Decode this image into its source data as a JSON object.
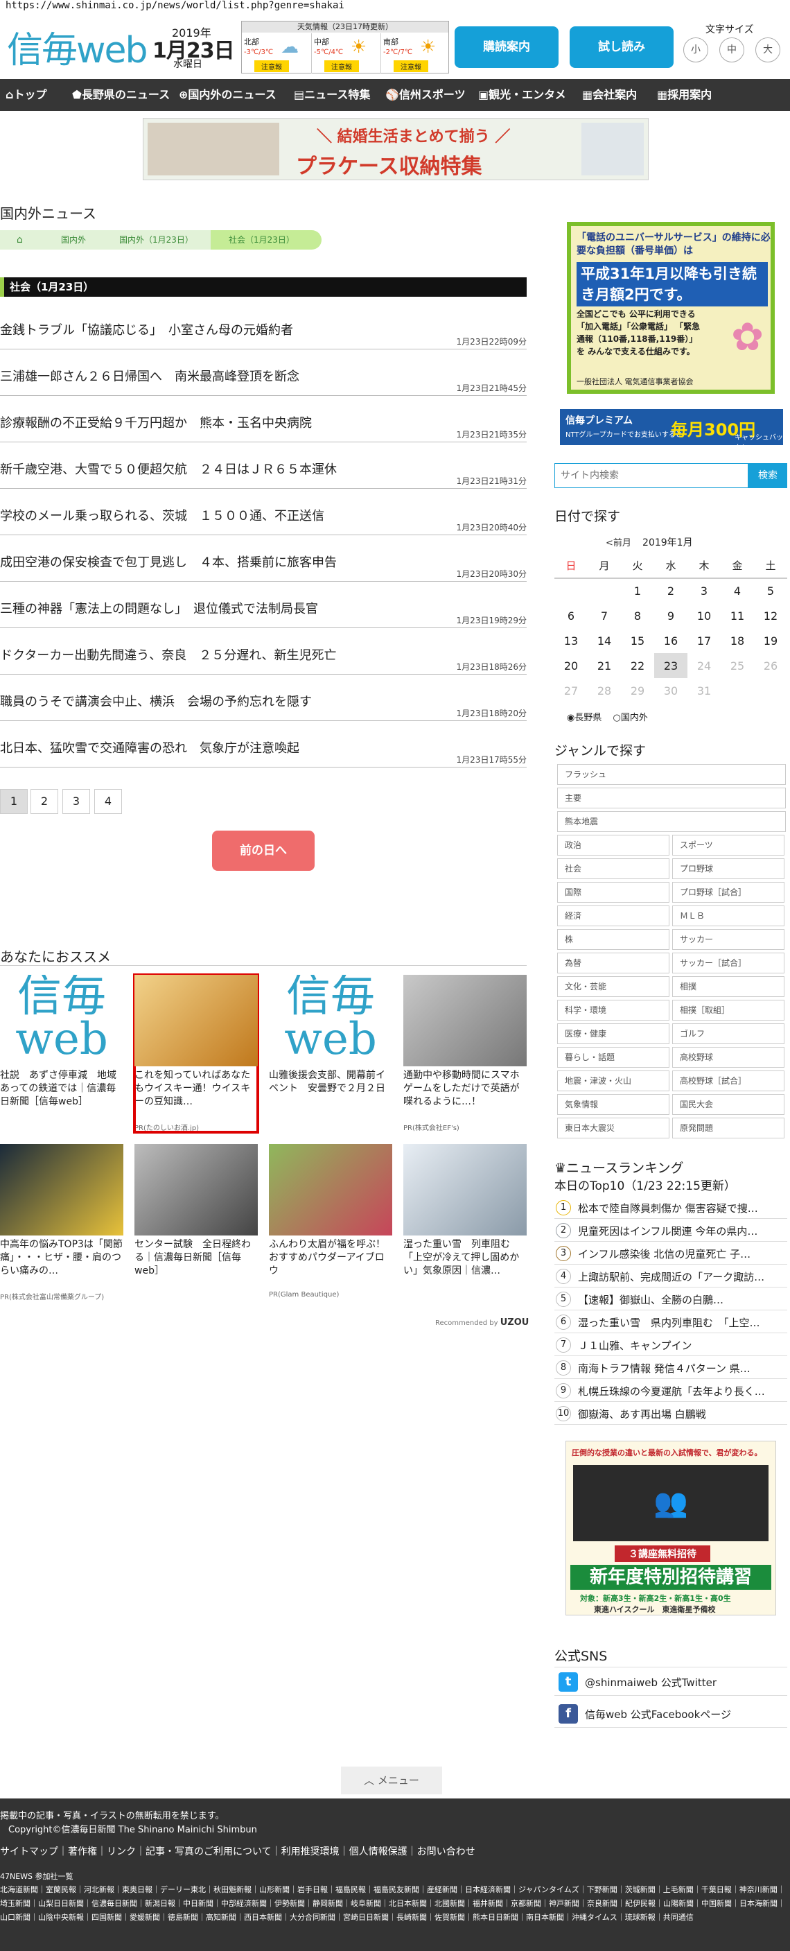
{
  "url": "https://www.shinmai.co.jp/news/world/list.php?genre=shakai",
  "logo": {
    "a": "信毎",
    "b": "web"
  },
  "date": {
    "year": "2019年",
    "day": "1月23日",
    "weekday": "水曜日"
  },
  "weather": {
    "header": "天気情報（23日17時更新）",
    "cells": [
      {
        "name": "北部",
        "temp": "-3℃/3℃",
        "warn": "注意報"
      },
      {
        "name": "中部",
        "temp": "-5℃/4℃",
        "warn": "注意報"
      },
      {
        "name": "南部",
        "temp": "-2℃/7℃",
        "warn": "注意報"
      }
    ]
  },
  "header_buttons": {
    "delivery": "購読案内",
    "trial": "試し読み"
  },
  "font_size": {
    "label": "文字サイズ",
    "s": "小",
    "m": "中",
    "l": "大"
  },
  "nav": [
    "トップ",
    "長野県のニュース",
    "国内外のニュース",
    "ニュース特集",
    "信州スポーツ",
    "観光・エンタメ",
    "会社案内",
    "採用案内"
  ],
  "banner_ad": {
    "line1": "＼ 結婚生活まとめて揃う ／",
    "line2": "プラケース収納特集"
  },
  "section_title": "国内外ニュース",
  "breadcrumbs": [
    "国内外",
    "国内外（1月23日）",
    "社会（1月23日）"
  ],
  "list_header": "社会（1月23日）",
  "news": [
    {
      "title": "金銭トラブル「協議応じる」　小室さん母の元婚約者",
      "time": "1月23日22時09分"
    },
    {
      "title": "三浦雄一郎さん２６日帰国へ　南米最高峰登頂を断念",
      "time": "1月23日21時45分"
    },
    {
      "title": "診療報酬の不正受給９千万円超か　熊本・玉名中央病院",
      "time": "1月23日21時35分"
    },
    {
      "title": "新千歳空港、大雪で５０便超欠航　２４日はＪＲ６５本運休",
      "time": "1月23日21時31分"
    },
    {
      "title": "学校のメール乗っ取られる、茨城　１５００通、不正送信",
      "time": "1月23日20時40分"
    },
    {
      "title": "成田空港の保安検査で包丁見逃し　４本、搭乗前に旅客申告",
      "time": "1月23日20時30分"
    },
    {
      "title": "三種の神器「憲法上の問題なし」　退位儀式で法制局長官",
      "time": "1月23日19時29分"
    },
    {
      "title": "ドクターカー出動先間違う、奈良　２５分遅れ、新生児死亡",
      "time": "1月23日18時26分"
    },
    {
      "title": "職員のうそで講演会中止、横浜　会場の予約忘れを隠す",
      "time": "1月23日18時20分"
    },
    {
      "title": "北日本、猛吹雪で交通障害の恐れ　気象庁が注意喚起",
      "time": "1月23日17時55分"
    }
  ],
  "pages": [
    "1",
    "2",
    "3",
    "4"
  ],
  "prev_button": "前の日へ",
  "recommend_title": "あなたにおススメ",
  "recommend": [
    {
      "caption": "社説　あずさ停車減　地域あっての鉄道では｜信濃毎日新聞［信毎web］",
      "pr": ""
    },
    {
      "caption": "これを知っていればあなたもウイスキー通！ウイスキーの豆知識…",
      "pr": "PR(たのしいお酒.jp)"
    },
    {
      "caption": "山雅後援会支部、開幕前イベント　安曇野で２月２日",
      "pr": ""
    },
    {
      "caption": "通勤中や移動時間にスマホゲームをしただけで英語が喋れるように…！",
      "pr": "PR(株式会社EF's)"
    },
    {
      "caption": "中高年の悩みTOP3は「関節痛」・・・ヒザ・腰・肩のつらい痛みの…",
      "pr": "PR(株式会社富山常備薬グループ)"
    },
    {
      "caption": "センター試験　全日程終わる｜信濃毎日新聞［信毎web］",
      "pr": ""
    },
    {
      "caption": "ふんわり太眉が福を呼ぶ！おすすめパウダーアイブロウ",
      "pr": "PR(Glam Beautique)"
    },
    {
      "caption": "湿った重い雪　列車阻む　「上空が冷えて押し固めかい」気象原因｜信濃…",
      "pr": ""
    }
  ],
  "recommended_by": "Recommended by",
  "uzou": "UZOU",
  "side_ad": {
    "line1": "「電話のユニバーサルサービス」の維持に必要な負担額（番号単価）は",
    "line2": "平成31年1月以降も引き続き月額2円です。",
    "line3": "全国どこでも 公平に利用できる 「加入電話」「公衆電話」 「緊急通報（110番,118番,119番）」を みんなで支える仕組みです。",
    "line4": "一般社団法人 電気通信事業者協会"
  },
  "side_ad2": {
    "a": "信毎プレミアム",
    "b": "NTTグループカードでお支払いすると",
    "c": "毎月300円",
    "d": "キャッシュバック！"
  },
  "search": {
    "placeholder": "サイト内検索",
    "button": "検索"
  },
  "calendar": {
    "title": "日付で探す",
    "prev": "<前月",
    "month": "2019年1月",
    "weekdays": [
      "日",
      "月",
      "火",
      "水",
      "木",
      "金",
      "土"
    ],
    "radio1": "長野県",
    "radio2": "国内外",
    "rows": [
      [
        "",
        "",
        "1",
        "2",
        "3",
        "4",
        "5"
      ],
      [
        "6",
        "7",
        "8",
        "9",
        "10",
        "11",
        "12"
      ],
      [
        "13",
        "14",
        "15",
        "16",
        "17",
        "18",
        "19"
      ],
      [
        "20",
        "21",
        "22",
        "23",
        "24",
        "25",
        "26"
      ],
      [
        "27",
        "28",
        "29",
        "30",
        "31",
        "",
        ""
      ]
    ]
  },
  "genre": {
    "title": "ジャンルで探す",
    "full": [
      "フラッシュ",
      "主要",
      "熊本地震"
    ],
    "pairs": [
      [
        "政治",
        "スポーツ"
      ],
      [
        "社会",
        "プロ野球"
      ],
      [
        "国際",
        "プロ野球［試合］"
      ],
      [
        "経済",
        "ＭＬＢ"
      ],
      [
        "株",
        "サッカー"
      ],
      [
        "為替",
        "サッカー［試合］"
      ],
      [
        "文化・芸能",
        "相撲"
      ],
      [
        "科学・環境",
        "相撲［取組］"
      ],
      [
        "医療・健康",
        "ゴルフ"
      ],
      [
        "暮らし・話題",
        "高校野球"
      ],
      [
        "地震・津波・火山",
        "高校野球［試合］"
      ],
      [
        "気象情報",
        "国民大会"
      ],
      [
        "東日本大震災",
        "原発問題"
      ]
    ]
  },
  "ranking": {
    "title": "ニュースランキング",
    "subtitle": "本日のTop10（1/23 22:15更新）",
    "items": [
      "松本で陸自隊員刺傷か 傷害容疑で捜…",
      "児童死因はインフル関連 今年の県内…",
      "インフル感染後 北信の児童死亡 子…",
      "上諏訪駅前、完成間近の「アーク諏訪…",
      "【速報】御嶽山、全勝の白鵬…",
      "湿った重い雪　県内列車阻む　「上空…",
      "Ｊ１山雅、キャンプイン",
      "南海トラフ情報 発信４パターン 県…",
      "札幌丘珠線の今夏運航「去年より長く…",
      "御嶽海、あす再出場 白鵬戦"
    ]
  },
  "side_ad3": {
    "top": "圧倒的な授業の違いと最新の入試情報で、君が変わる。",
    "badge": "３講座無料招待",
    "main": "新年度特別招待講習",
    "sub": "対象：新高3生・新高2生・新高1生・高0生",
    "brand": "東進ハイスクール　東進衛星予備校"
  },
  "sns": {
    "title": "公式SNS",
    "twitter": "@shinmaiweb 公式Twitter",
    "facebook": "信毎web 公式Facebookページ"
  },
  "menu_button": "メニュー",
  "footer": {
    "notice": "掲載中の記事・写真・イラストの無断転用を禁じます。",
    "copyright": "Copyright©信濃毎日新聞 The Shinano Mainichi Shimbun",
    "links": "サイトマップ｜著作権｜リンク｜記事・写真のご利用について｜利用推奨環境｜個人情報保護｜お問い合わせ",
    "news47": "47NEWS 参加社一覧",
    "papers": "北海道新聞｜室蘭民報｜河北新報｜東奥日報｜デーリー東北｜秋田魁新報｜山形新聞｜岩手日報｜福島民報｜福島民友新聞｜産経新聞｜日本経済新聞｜ジャパンタイムズ｜下野新聞｜茨城新聞｜上毛新聞｜千葉日報｜神奈川新聞｜埼玉新聞｜山梨日日新聞｜信濃毎日新聞｜新潟日報｜中日新聞｜中部経済新聞｜伊勢新聞｜静岡新聞｜岐阜新聞｜北日本新聞｜北國新聞｜福井新聞｜京都新聞｜神戸新聞｜奈良新聞｜紀伊民報｜山陽新聞｜中国新聞｜日本海新聞｜山口新聞｜山陰中央新報｜四国新聞｜愛媛新聞｜徳島新聞｜高知新聞｜西日本新聞｜大分合同新聞｜宮崎日日新聞｜長崎新聞｜佐賀新聞｜熊本日日新聞｜南日本新聞｜沖縄タイムス｜琉球新報｜共同通信"
  }
}
